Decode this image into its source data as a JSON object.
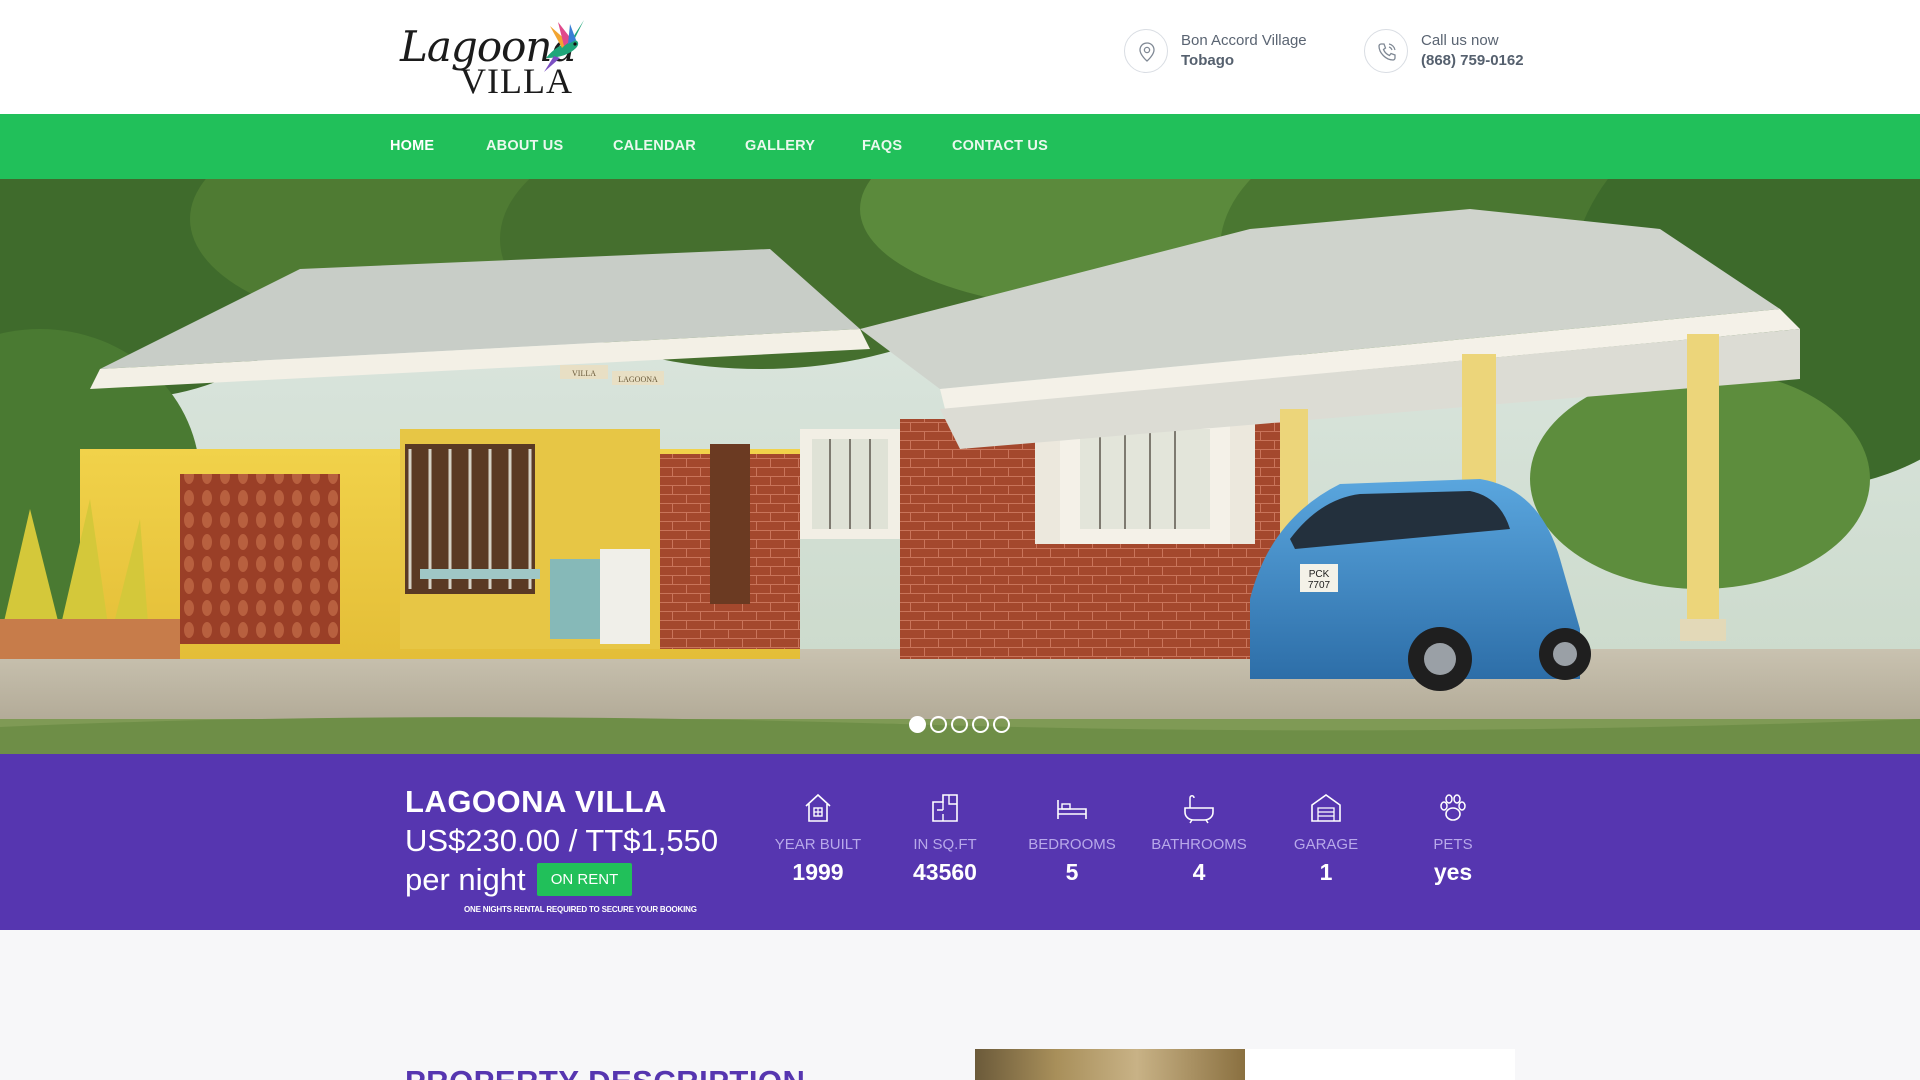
{
  "brand": {
    "logo_script": "Lagoona",
    "logo_villa": "VILLA",
    "logo_icon": "hummingbird-icon"
  },
  "contact": {
    "location_icon": "map-pin-icon",
    "location_line1": "Bon Accord Village",
    "location_line2": "Tobago",
    "phone_icon": "phone-icon",
    "phone_line1": "Call us now",
    "phone_line2": "(868) 759-0162"
  },
  "nav": {
    "items": [
      {
        "label": "HOME",
        "active": true
      },
      {
        "label": "ABOUT US",
        "active": false
      },
      {
        "label": "CALENDAR",
        "active": false
      },
      {
        "label": "GALLERY",
        "active": false
      },
      {
        "label": "FAQS",
        "active": false
      },
      {
        "label": "CONTACT US",
        "active": false
      }
    ]
  },
  "hero": {
    "slides_count": 5,
    "active_slide": 1,
    "sign_left": "VILLA",
    "sign_right": "LAGOONA",
    "plate_line1": "PCK",
    "plate_line2": "7707"
  },
  "property": {
    "name": "LAGOONA VILLA",
    "price": "US$230.00 / TT$1,550",
    "per": "per night",
    "badge": "ON RENT",
    "note": "ONE NIGHTS RENTAL REQUIRED TO SECURE YOUR BOOKING",
    "stats": [
      {
        "icon": "house-icon",
        "label": "YEAR BUILT",
        "value": "1999"
      },
      {
        "icon": "floorplan-icon",
        "label": "IN SQ.FT",
        "value": "43560"
      },
      {
        "icon": "bed-icon",
        "label": "BEDROOMS",
        "value": "5"
      },
      {
        "icon": "bathtub-icon",
        "label": "BATHROOMS",
        "value": "4"
      },
      {
        "icon": "garage-icon",
        "label": "GARAGE",
        "value": "1"
      },
      {
        "icon": "paw-icon",
        "label": "PETS",
        "value": "yes"
      }
    ]
  },
  "section": {
    "title": "PROPERTY DESCRIPTION"
  },
  "colors": {
    "nav_green": "#21c05a",
    "info_purple": "#5636b0",
    "badge_green": "#21c05a"
  }
}
